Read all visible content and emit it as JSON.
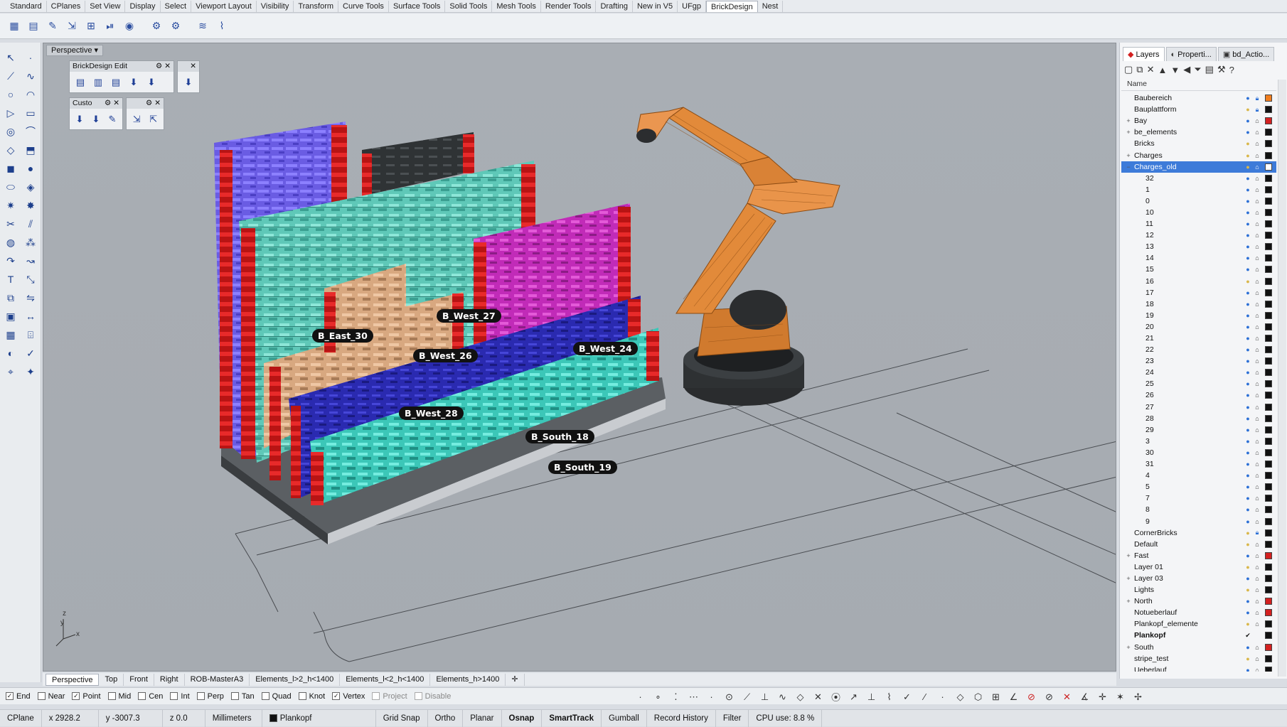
{
  "top_tabs": [
    "Standard",
    "CPlanes",
    "Set View",
    "Display",
    "Select",
    "Viewport Layout",
    "Visibility",
    "Transform",
    "Curve Tools",
    "Surface Tools",
    "Solid Tools",
    "Mesh Tools",
    "Render Tools",
    "Drafting",
    "New in V5",
    "UFgp",
    "BrickDesign",
    "Nest"
  ],
  "active_top_tab": "BrickDesign",
  "viewport": {
    "title": "Perspective",
    "panels": {
      "brickdesign_title": "BrickDesign Edit",
      "custom_title": "Custo"
    },
    "labels": {
      "east30": "B_East_30",
      "west27": "B_West_27",
      "west26": "B_West_26",
      "west24": "B_West_24",
      "west28": "B_West_28",
      "south18": "B_South_18",
      "south19": "B_South_19"
    },
    "axis": {
      "x": "x",
      "y": "y",
      "z": "z"
    }
  },
  "right_panel": {
    "tabs": [
      "Layers",
      "Properti...",
      "bd_Actio..."
    ],
    "active_tab": "Layers",
    "column_name": "Name",
    "layers": [
      {
        "name": "Baubereich",
        "exp": "",
        "bulb": "on",
        "lock": "locked",
        "color": "#f07d1e"
      },
      {
        "name": "Bauplattform",
        "exp": "",
        "bulb": "off",
        "lock": "locked",
        "color": "#111111"
      },
      {
        "name": "Bay",
        "exp": "+",
        "bulb": "on",
        "lock": "open",
        "color": "#d32020"
      },
      {
        "name": "be_elements",
        "exp": "+",
        "bulb": "on",
        "lock": "open",
        "color": "#111111"
      },
      {
        "name": "Bricks",
        "exp": "",
        "bulb": "off",
        "lock": "open",
        "color": "#111111"
      },
      {
        "name": "Charges",
        "exp": "+",
        "bulb": "off",
        "lock": "open",
        "color": "#111111"
      },
      {
        "name": "Charges_old",
        "exp": "−",
        "bulb": "off",
        "lock": "open",
        "color": "#ffffff",
        "selected": true
      },
      {
        "name": "32",
        "exp": "",
        "indent": true,
        "bulb": "on",
        "lock": "open",
        "color": "#111111"
      },
      {
        "name": "1",
        "exp": "",
        "indent": true,
        "bulb": "on",
        "lock": "open",
        "color": "#111111"
      },
      {
        "name": "0",
        "exp": "",
        "indent": true,
        "bulb": "on",
        "lock": "open",
        "color": "#111111"
      },
      {
        "name": "10",
        "exp": "",
        "indent": true,
        "bulb": "on",
        "lock": "open",
        "color": "#111111"
      },
      {
        "name": "11",
        "exp": "",
        "indent": true,
        "bulb": "on",
        "lock": "open",
        "color": "#111111"
      },
      {
        "name": "12",
        "exp": "",
        "indent": true,
        "bulb": "on",
        "lock": "open",
        "color": "#111111"
      },
      {
        "name": "13",
        "exp": "",
        "indent": true,
        "bulb": "on",
        "lock": "open",
        "color": "#111111"
      },
      {
        "name": "14",
        "exp": "",
        "indent": true,
        "bulb": "on",
        "lock": "open",
        "color": "#111111"
      },
      {
        "name": "15",
        "exp": "",
        "indent": true,
        "bulb": "on",
        "lock": "open",
        "color": "#111111"
      },
      {
        "name": "16",
        "exp": "",
        "indent": true,
        "bulb": "off",
        "lock": "open",
        "color": "#111111"
      },
      {
        "name": "17",
        "exp": "",
        "indent": true,
        "bulb": "on",
        "lock": "open",
        "color": "#111111"
      },
      {
        "name": "18",
        "exp": "",
        "indent": true,
        "bulb": "on",
        "lock": "open",
        "color": "#111111"
      },
      {
        "name": "19",
        "exp": "",
        "indent": true,
        "bulb": "on",
        "lock": "open",
        "color": "#111111"
      },
      {
        "name": "20",
        "exp": "",
        "indent": true,
        "bulb": "on",
        "lock": "open",
        "color": "#111111"
      },
      {
        "name": "21",
        "exp": "",
        "indent": true,
        "bulb": "on",
        "lock": "open",
        "color": "#111111"
      },
      {
        "name": "22",
        "exp": "",
        "indent": true,
        "bulb": "on",
        "lock": "open",
        "color": "#111111"
      },
      {
        "name": "23",
        "exp": "",
        "indent": true,
        "bulb": "on",
        "lock": "open",
        "color": "#111111"
      },
      {
        "name": "24",
        "exp": "",
        "indent": true,
        "bulb": "on",
        "lock": "open",
        "color": "#111111"
      },
      {
        "name": "25",
        "exp": "",
        "indent": true,
        "bulb": "on",
        "lock": "open",
        "color": "#111111"
      },
      {
        "name": "26",
        "exp": "",
        "indent": true,
        "bulb": "on",
        "lock": "open",
        "color": "#111111"
      },
      {
        "name": "27",
        "exp": "",
        "indent": true,
        "bulb": "on",
        "lock": "open",
        "color": "#111111"
      },
      {
        "name": "28",
        "exp": "",
        "indent": true,
        "bulb": "on",
        "lock": "open",
        "color": "#111111"
      },
      {
        "name": "29",
        "exp": "",
        "indent": true,
        "bulb": "on",
        "lock": "open",
        "color": "#111111"
      },
      {
        "name": "3",
        "exp": "",
        "indent": true,
        "bulb": "on",
        "lock": "open",
        "color": "#111111"
      },
      {
        "name": "30",
        "exp": "",
        "indent": true,
        "bulb": "on",
        "lock": "open",
        "color": "#111111"
      },
      {
        "name": "31",
        "exp": "",
        "indent": true,
        "bulb": "on",
        "lock": "open",
        "color": "#111111"
      },
      {
        "name": "4",
        "exp": "",
        "indent": true,
        "bulb": "on",
        "lock": "open",
        "color": "#111111"
      },
      {
        "name": "5",
        "exp": "",
        "indent": true,
        "bulb": "on",
        "lock": "open",
        "color": "#111111"
      },
      {
        "name": "7",
        "exp": "",
        "indent": true,
        "bulb": "on",
        "lock": "open",
        "color": "#111111"
      },
      {
        "name": "8",
        "exp": "",
        "indent": true,
        "bulb": "on",
        "lock": "open",
        "color": "#111111"
      },
      {
        "name": "9",
        "exp": "",
        "indent": true,
        "bulb": "on",
        "lock": "open",
        "color": "#111111"
      },
      {
        "name": "CornerBricks",
        "exp": "",
        "bulb": "off",
        "lock": "locked",
        "color": "#111111"
      },
      {
        "name": "Default",
        "exp": "",
        "bulb": "off",
        "lock": "open",
        "color": "#111111"
      },
      {
        "name": "Fast",
        "exp": "+",
        "bulb": "on",
        "lock": "open",
        "color": "#d32020"
      },
      {
        "name": "Layer 01",
        "exp": "",
        "bulb": "off",
        "lock": "open",
        "color": "#111111"
      },
      {
        "name": "Layer 03",
        "exp": "+",
        "bulb": "on",
        "lock": "open",
        "color": "#111111"
      },
      {
        "name": "Lights",
        "exp": "",
        "bulb": "off",
        "lock": "open",
        "color": "#111111"
      },
      {
        "name": "North",
        "exp": "+",
        "bulb": "on",
        "lock": "open",
        "color": "#d32020"
      },
      {
        "name": "Notueberlauf",
        "exp": "",
        "bulb": "on",
        "lock": "open",
        "color": "#d32020"
      },
      {
        "name": "Plankopf_elemente",
        "exp": "",
        "bulb": "off",
        "lock": "open",
        "color": "#111111"
      },
      {
        "name": "Plankopf",
        "exp": "",
        "bulb": "check",
        "lock": "",
        "color": "#111111",
        "current": true
      },
      {
        "name": "South",
        "exp": "+",
        "bulb": "on",
        "lock": "open",
        "color": "#d32020"
      },
      {
        "name": "stripe_test",
        "exp": "",
        "bulb": "off",
        "lock": "open",
        "color": "#111111"
      },
      {
        "name": "Ueberlauf",
        "exp": "",
        "bulb": "on",
        "lock": "open",
        "color": "#111111"
      }
    ]
  },
  "viewport_tabs": [
    "Perspective",
    "Top",
    "Front",
    "Right",
    "ROB-MasterA3",
    "Elements_l>2_h<1400",
    "Elements_l<2_h<1400",
    "Elements_h>1400"
  ],
  "active_viewport_tab": "Perspective",
  "osnaps": [
    {
      "label": "End",
      "checked": true
    },
    {
      "label": "Near",
      "checked": false
    },
    {
      "label": "Point",
      "checked": true
    },
    {
      "label": "Mid",
      "checked": false
    },
    {
      "label": "Cen",
      "checked": false
    },
    {
      "label": "Int",
      "checked": false
    },
    {
      "label": "Perp",
      "checked": false
    },
    {
      "label": "Tan",
      "checked": false
    },
    {
      "label": "Quad",
      "checked": false
    },
    {
      "label": "Knot",
      "checked": false
    },
    {
      "label": "Vertex",
      "checked": true
    },
    {
      "label": "Project",
      "checked": false,
      "dim": true
    },
    {
      "label": "Disable",
      "checked": false,
      "dim": true
    }
  ],
  "status": {
    "cplane": "CPlane",
    "x": "x 2928.2",
    "y": "y -3007.3",
    "z": "z 0.0",
    "units": "Millimeters",
    "layer": "Plankopf",
    "grid_snap": "Grid Snap",
    "ortho": "Ortho",
    "planar": "Planar",
    "osnap": "Osnap",
    "smarttrack": "SmartTrack",
    "gumball": "Gumball",
    "record_history": "Record History",
    "filter": "Filter",
    "cpu": "CPU use: 8.8 %"
  }
}
